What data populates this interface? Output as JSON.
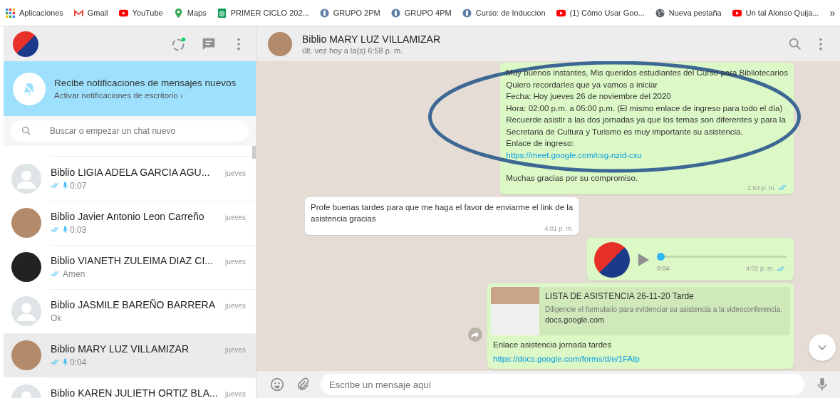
{
  "bookmarks_bar": {
    "items": [
      {
        "label": "Aplicaciones",
        "kind": "apps"
      },
      {
        "label": "Gmail",
        "kind": "gmail"
      },
      {
        "label": "YouTube",
        "kind": "youtube"
      },
      {
        "label": "Maps",
        "kind": "maps"
      },
      {
        "label": "PRIMER CICLO 202...",
        "kind": "sheets"
      },
      {
        "label": "GRUPO 2PM",
        "kind": "badge"
      },
      {
        "label": "GRUPO 4PM",
        "kind": "badge"
      },
      {
        "label": "Curso: de Induccion",
        "kind": "badge"
      },
      {
        "label": "(1) Cómo Usar Goo...",
        "kind": "youtube"
      },
      {
        "label": "Nueva pestaña",
        "kind": "globe"
      },
      {
        "label": "Un tal Alonso Quija...",
        "kind": "youtube"
      }
    ],
    "overflow": "»"
  },
  "notification_banner": {
    "title": "Recibe notificaciones de mensajes nuevos",
    "action": "Activar notificaciones de escritorio ›"
  },
  "search": {
    "placeholder": "Buscar o empezar un chat nuevo"
  },
  "chats": [
    {
      "name": "Biblio LIGIA ADELA GARCIA AGU...",
      "time": "jueves",
      "kind": "default",
      "read": true,
      "voice": true,
      "preview": "0:07",
      "selected": false
    },
    {
      "name": "Biblio Javier Antonio Leon Carreño",
      "time": "jueves",
      "kind": "photo",
      "read": true,
      "voice": true,
      "preview": "0:03",
      "selected": false
    },
    {
      "name": "Biblio VIANETH ZULEIMA DIAZ CI...",
      "time": "jueves",
      "kind": "dark",
      "read": true,
      "voice": false,
      "preview": "Amen",
      "selected": false
    },
    {
      "name": "Biblio JASMILE BAREÑO BARRERA",
      "time": "jueves",
      "kind": "default",
      "read": false,
      "voice": false,
      "preview": "Ok",
      "selected": false
    },
    {
      "name": "Biblio MARY LUZ VILLAMIZAR",
      "time": "jueves",
      "kind": "photo",
      "read": true,
      "voice": true,
      "preview": "0:04",
      "selected": true
    },
    {
      "name": "Biblio KAREN JULIETH ORTIZ BLA...",
      "time": "jueves",
      "kind": "default",
      "selected": false
    }
  ],
  "conversation": {
    "name": "Biblio MARY LUZ VILLAMIZAR",
    "status": "últ. vez hoy a la(s) 6:58 p. m."
  },
  "messages": [
    {
      "kind": "text",
      "outgoing": true,
      "read": true,
      "lines": [
        "Muy buenos instantes, Mis queridos estudiantes del Curso para Bibliotecarios",
        "Quiero recordarles que ya vamos a iniciar",
        "Fecha: Hoy  jueves 26 de noviembre del 2020",
        "Hora:  02:00 p.m. a 05:00 p.m. (El mismo enlace de ingreso para todo el día)",
        "Recuerde asistir a las dos jornadas ya que los temas son diferentes y para la",
        "Secretaria de Cultura y Turismo es muy importante su asistencia.",
        "Enlace de ingreso:"
      ],
      "link": "https://meet.google.com/csg-nzid-cxu",
      "closing": "Muchas gracias por su compromiso.",
      "time": "1:54 p. m."
    },
    {
      "kind": "text",
      "outgoing": false,
      "lines": [
        "Profe buenas tardes para que me haga el favor de enviarme el link de la",
        "asistencia gracias"
      ],
      "time": "4:01 p. m."
    },
    {
      "kind": "voice",
      "outgoing": true,
      "read": true,
      "duration": "0:04",
      "level": 0,
      "time": "4:02 p. m."
    },
    {
      "kind": "link",
      "outgoing": true,
      "preview_title": "LISTA DE ASISTENCIA 26-11-20 Tarde",
      "preview_description": "Diligencie el formulario para evidenciar su asistencia a la videoconferencia.",
      "preview_domain": "docs.google.com",
      "text": "Enlace asistencia jornada tardes",
      "link": "https://docs.google.com/forms/d/e/1FAIp"
    }
  ],
  "composer": {
    "placeholder": "Escribe un mensaje aquí"
  }
}
